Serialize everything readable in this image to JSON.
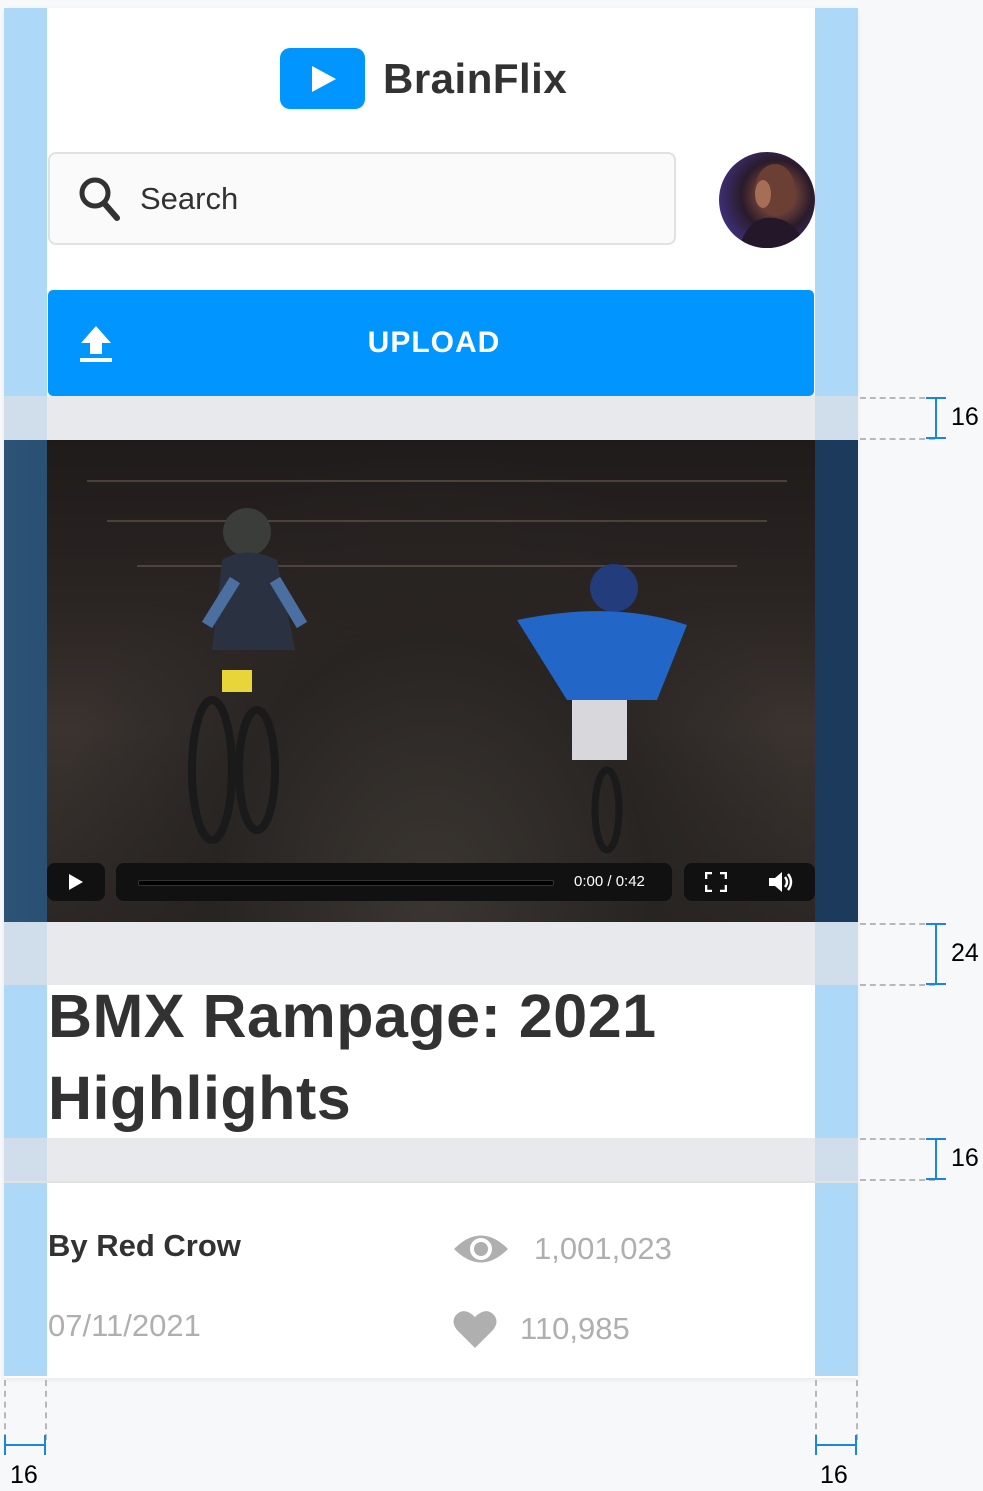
{
  "brand": {
    "name": "BrainFlix",
    "accent": "#0095ff",
    "logo_icon": "play-icon"
  },
  "search": {
    "placeholder": "Search",
    "icon": "search-icon"
  },
  "avatar": {
    "icon": "user-avatar"
  },
  "upload": {
    "label": "UPLOAD",
    "icon": "upload-icon"
  },
  "player": {
    "time": "0:00 / 0:42",
    "progress": 0,
    "controls": [
      "play-icon",
      "fullscreen-icon",
      "volume-icon"
    ]
  },
  "video": {
    "title": "BMX Rampage: 2021 Highlights",
    "author": "By Red Crow",
    "date": "07/11/2021",
    "views": "1,001,023",
    "likes": "110,985"
  },
  "spec": {
    "gap_after_upload": "16",
    "gap_after_player": "24",
    "gap_after_title": "16",
    "margin_left": "16",
    "margin_right": "16"
  },
  "colors": {
    "text": "#323232",
    "muted": "#afafaf",
    "margin_overlay": "#aed8f8",
    "measure": "#1b86e0"
  }
}
